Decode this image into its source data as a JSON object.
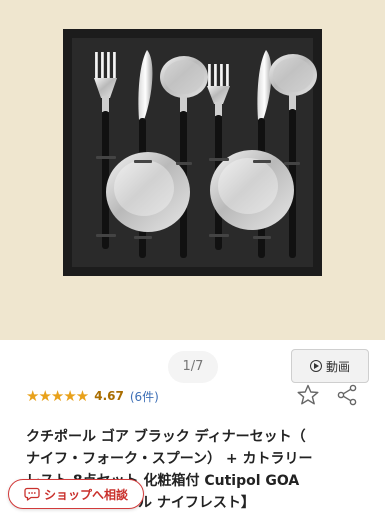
{
  "photo": {
    "alt_subject": "cutlery-set-in-gift-box"
  },
  "gallery": {
    "page_indicator": "1/7",
    "video_label": "動画"
  },
  "rating": {
    "stars_text": "★★★★★",
    "value": "4.67",
    "review_count": "(6件)"
  },
  "product": {
    "title_line1": "クチポール ゴア ブラック ディナーセット（",
    "title_line2": "ナイフ・フォーク・スプーン） + カトラリー",
    "title_line3": "レスト 8点セット 化粧箱付 Cutipol GOA",
    "title_line4": "【ク　　　チポール ナイフレスト】"
  },
  "consult": {
    "label": "ショップへ相談"
  },
  "colors": {
    "accent_red": "#d23a3a",
    "star": "#e8a11b",
    "link_blue": "#3d6fb6"
  }
}
